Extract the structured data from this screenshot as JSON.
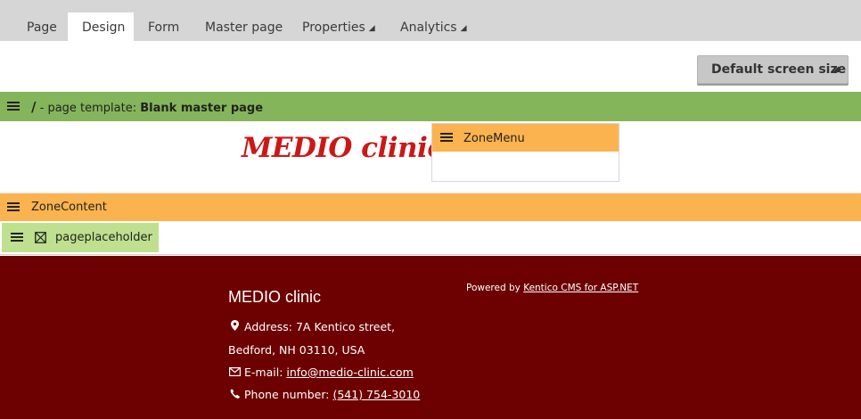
{
  "tabs": [
    {
      "label": "Page"
    },
    {
      "label": "Design"
    },
    {
      "label": "Form"
    },
    {
      "label": "Master page"
    },
    {
      "label": "Properties"
    },
    {
      "label": "Analytics"
    }
  ],
  "active_tab": "Design",
  "screen_size": {
    "label": "Default screen size"
  },
  "template_bar": {
    "path": "/",
    "prefix": "- page template:",
    "name": "Blank master page"
  },
  "logo_text": "MEDIO clinic",
  "zones": {
    "menu": "ZoneMenu",
    "content": "ZoneContent",
    "placeholder": "pageplaceholder"
  },
  "footer": {
    "title": "MEDIO clinic",
    "address_line1": "Address: 7A Kentico street,",
    "address_line2": "Bedford, NH 03110, USA",
    "email_label": "E-mail:",
    "email": "info@medio-clinic.com",
    "phone_label": "Phone number:",
    "phone": "(541) 754-3010",
    "powered_prefix": "Powered by",
    "powered_link": "Kentico CMS for ASP.NET"
  },
  "colors": {
    "template_bar": "#85b55a",
    "zone": "#fbb34f",
    "placeholder": "#bfe08f",
    "footer": "#6d0000",
    "logo": "#cc1717"
  }
}
